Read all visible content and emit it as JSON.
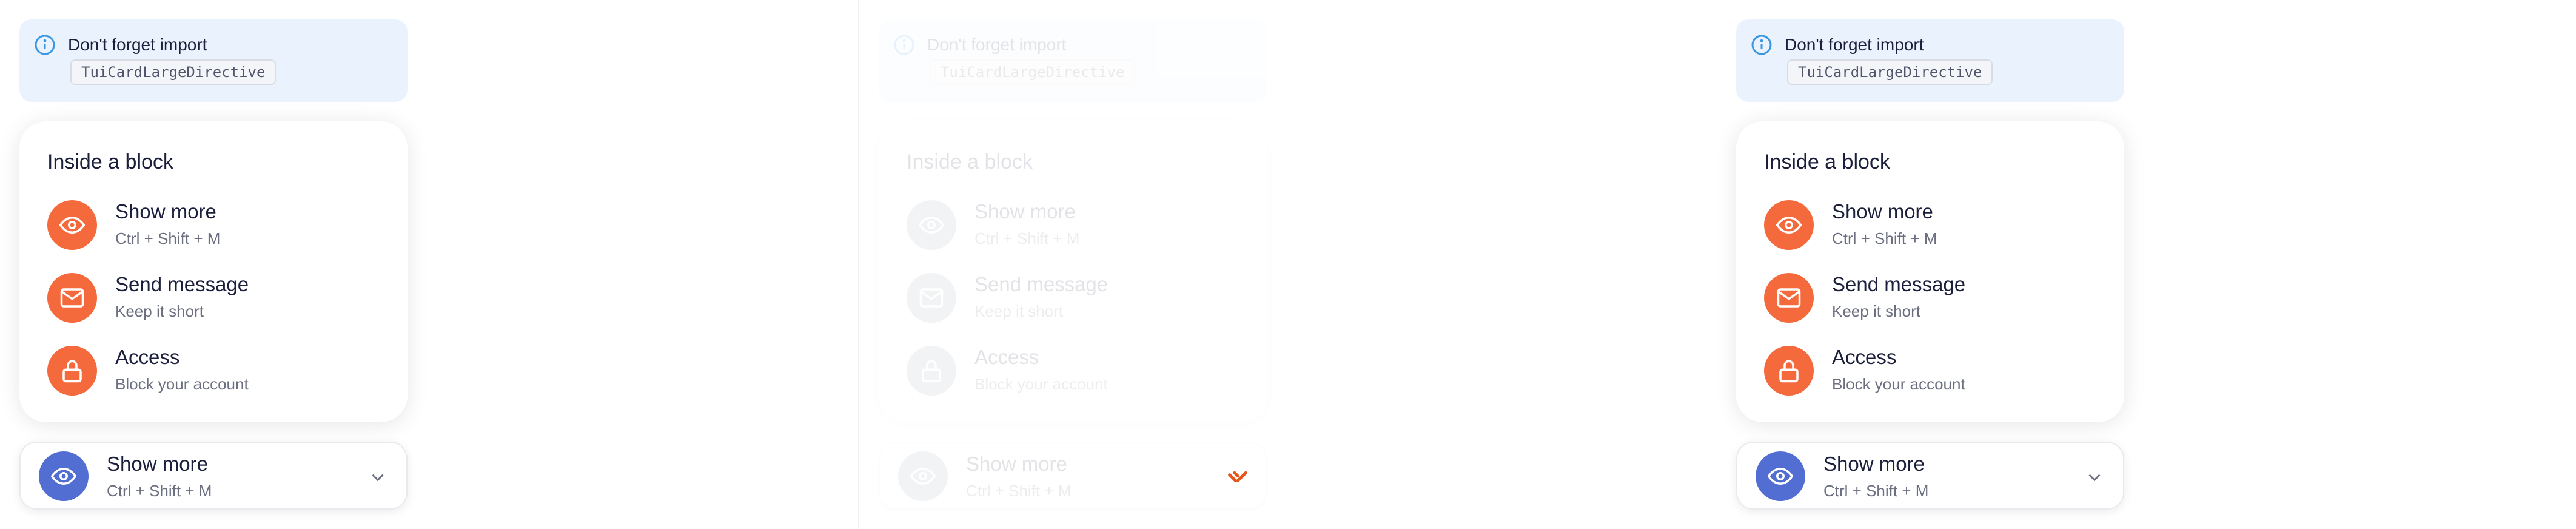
{
  "notice": {
    "text": "Don't forget import",
    "code": "TuiCardLargeDirective",
    "icon": "info-icon"
  },
  "card": {
    "title": "Inside a block",
    "items": [
      {
        "title": "Show more",
        "subtitle": "Ctrl + Shift + M",
        "icon": "eye-icon"
      },
      {
        "title": "Send message",
        "subtitle": "Keep it short",
        "icon": "mail-icon"
      },
      {
        "title": "Access",
        "subtitle": "Block your account",
        "icon": "lock-icon"
      }
    ]
  },
  "dropdown": {
    "title": "Show more",
    "subtitle": "Ctrl + Shift + M",
    "icon": "eye-icon",
    "indicator": "chevron-down-icon",
    "loading_indicator": "spinner-icon"
  },
  "colors": {
    "orange_avatar": "#f46a3c",
    "blue_avatar": "#526ed3",
    "notice_bg": "#eaf3fd",
    "info_blue": "#3b96e2",
    "spinner": "#e8541c"
  }
}
